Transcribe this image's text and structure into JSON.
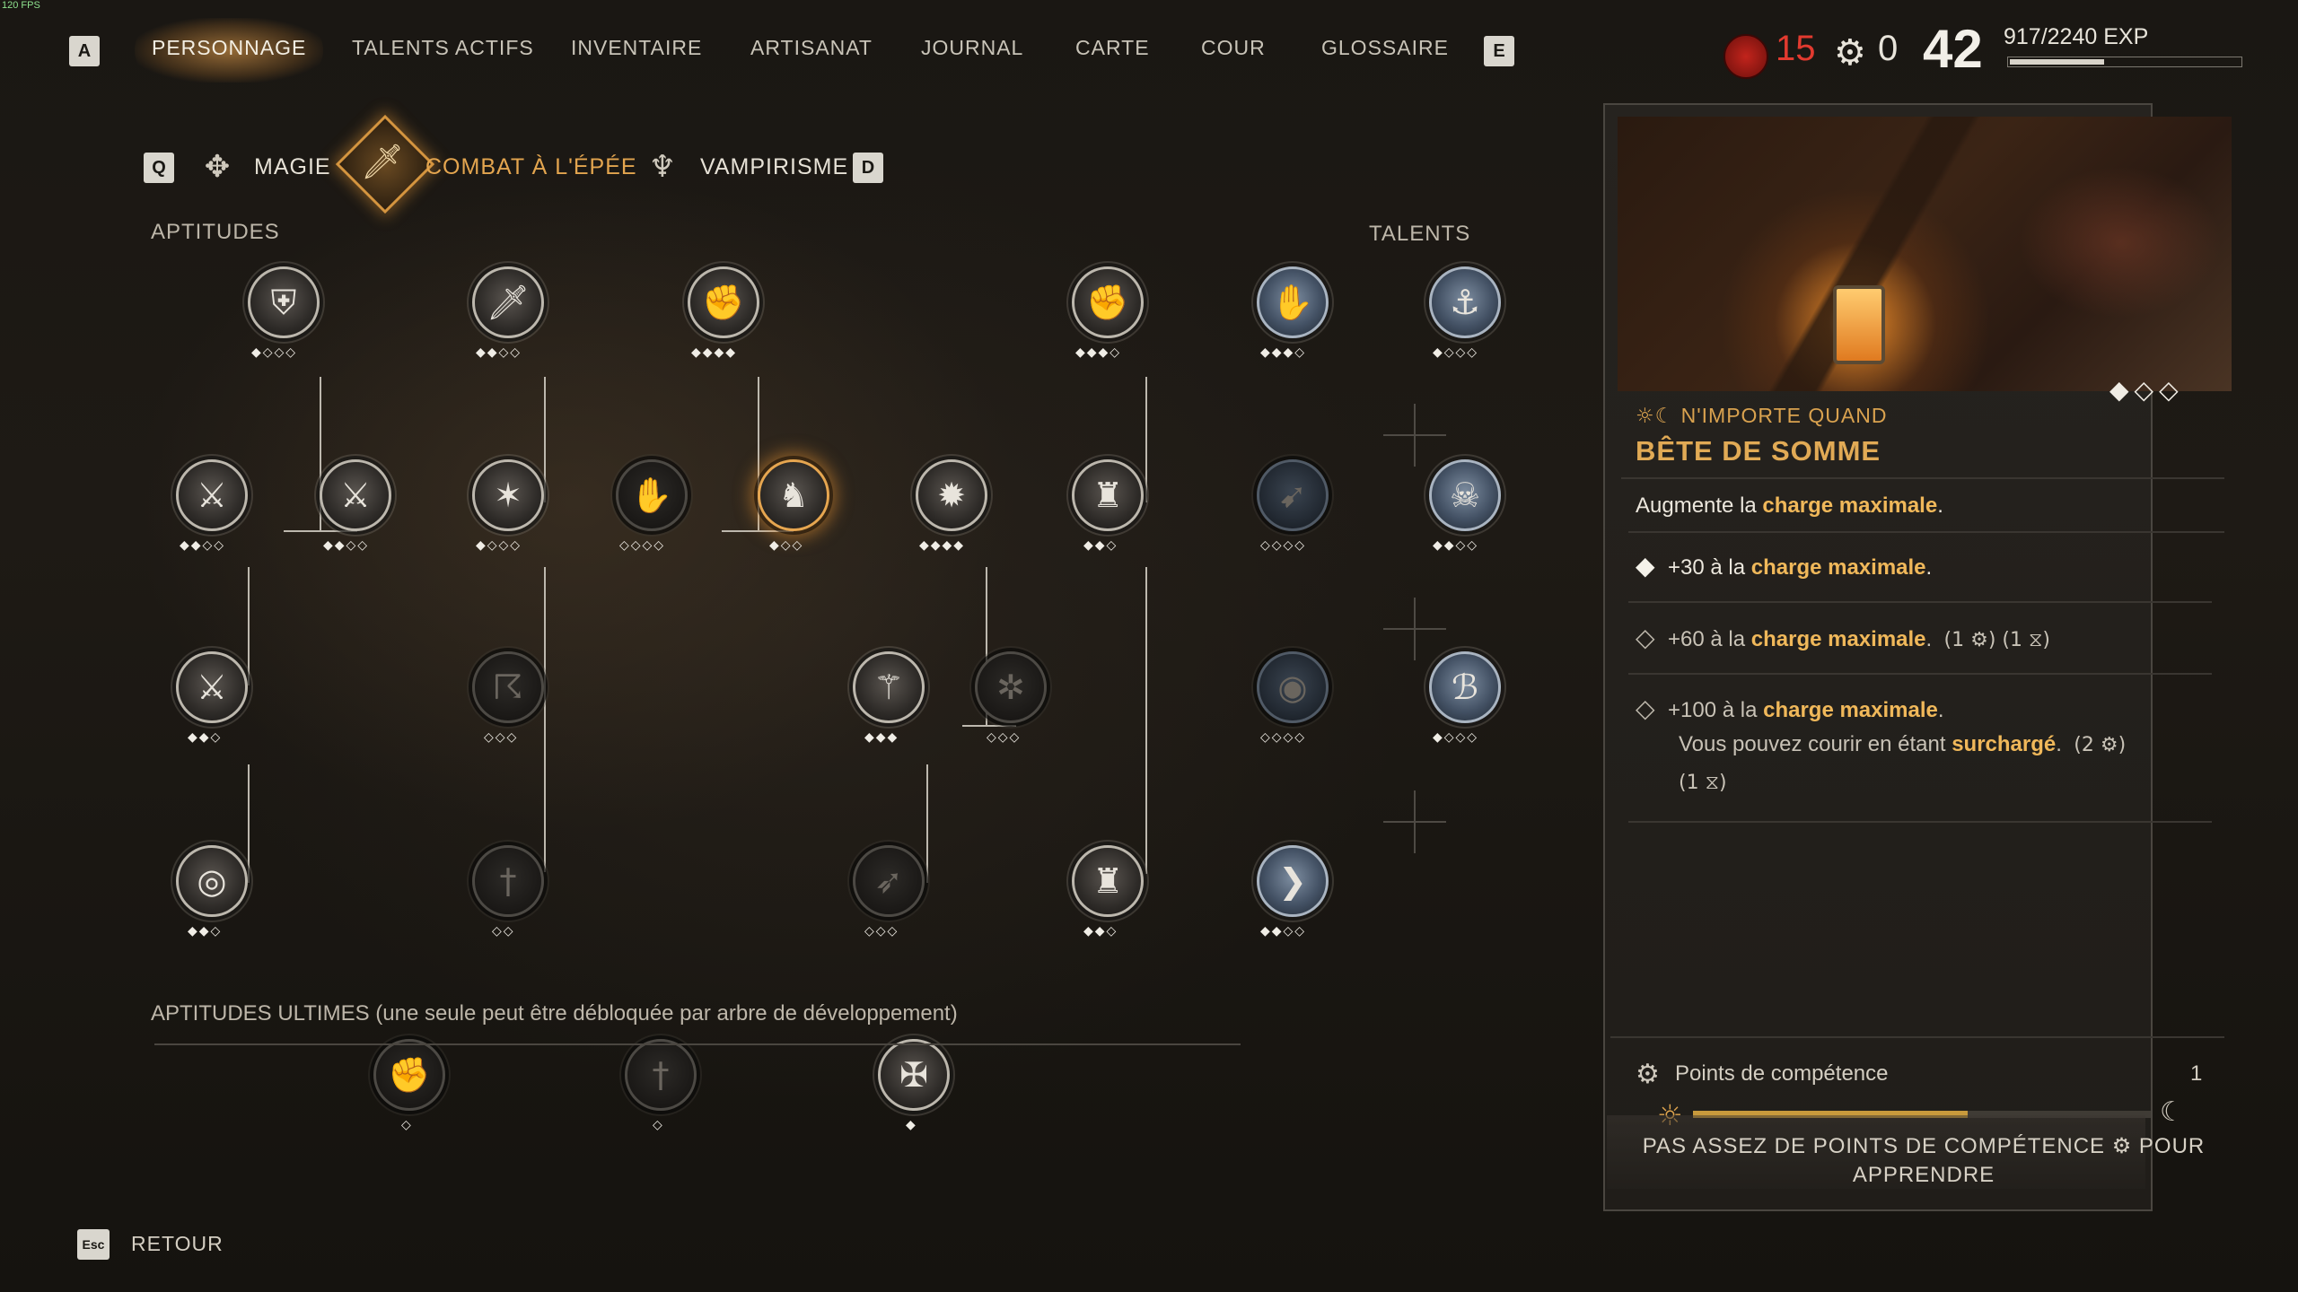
{
  "fps": "120 FPS",
  "nav": {
    "key_left": "A",
    "key_right": "E",
    "items": [
      "PERSONNAGE",
      "TALENTS ACTIFS",
      "INVENTAIRE",
      "ARTISANAT",
      "JOURNAL",
      "CARTE",
      "COUR",
      "GLOSSAIRE"
    ],
    "active_index": 0
  },
  "stats": {
    "red_value": "15",
    "gear_value": "0",
    "level": "42",
    "exp_text": "917/2240 EXP",
    "exp_progress": 0.409
  },
  "categories": {
    "key_left": "Q",
    "key_right": "D",
    "items": [
      "MAGIE",
      "COMBAT À L'ÉPÉE",
      "VAMPIRISME"
    ],
    "active_index": 1
  },
  "sections": {
    "aptitudes": "APTITUDES",
    "talents": "TALENTS",
    "ultimes": "APTITUDES ULTIMES (une seule peut être débloquée par arbre de développement)"
  },
  "skills": [
    {
      "icon": "shield-icon",
      "diamonds": "◆◇◇◇",
      "dim": false
    },
    {
      "icon": "dagger-icon",
      "diamonds": "◆◆◇◇",
      "dim": false
    },
    {
      "icon": "strength-icon",
      "diamonds": "◆◆◆◆",
      "dim": false
    },
    {
      "icon": "fist-icon",
      "diamonds": "◆◆◆◇",
      "dim": false
    },
    {
      "icon": "slash-icon",
      "diamonds": "◆◆◇◇",
      "dim": false
    },
    {
      "icon": "crossed-swords-icon",
      "diamonds": "◆◆◇◇",
      "dim": false
    },
    {
      "icon": "sword-burst-icon",
      "diamonds": "◆◇◇◇",
      "dim": false
    },
    {
      "icon": "claw-icon",
      "diamonds": "◇◇◇◇",
      "dim": true
    },
    {
      "icon": "pack-mule-icon",
      "diamonds": "◆◇◇",
      "dim": false,
      "selected": true
    },
    {
      "icon": "rage-icon",
      "diamonds": "◆◆◆◆",
      "dim": false
    },
    {
      "icon": "armor-icon",
      "diamonds": "◆◆◇",
      "dim": false
    },
    {
      "icon": "sword-swing-icon",
      "diamonds": "◆◆◇",
      "dim": false
    },
    {
      "icon": "hook-icon",
      "diamonds": "◇◇◇",
      "dim": true
    },
    {
      "icon": "blade-fan-icon",
      "diamonds": "◆◆◆",
      "dim": false
    },
    {
      "icon": "target-wheel-icon",
      "diamonds": "◇◇◇",
      "dim": true
    },
    {
      "icon": "bullseye-icon",
      "diamonds": "◆◆◇",
      "dim": false
    },
    {
      "icon": "sheathed-sword-icon",
      "diamonds": "◇◇",
      "dim": true
    },
    {
      "icon": "lunge-icon",
      "diamonds": "◇◇◇",
      "dim": true
    },
    {
      "icon": "plate-armor-icon",
      "diamonds": "◆◆◇",
      "dim": false
    }
  ],
  "talents": [
    {
      "icon": "hand-icon",
      "diamonds": "◆◆◆◇",
      "dim": false
    },
    {
      "icon": "anchor-icon",
      "diamonds": "◆◇◇◇",
      "dim": false
    },
    {
      "icon": "dash-icon",
      "diamonds": "◇◇◇◇",
      "dim": true
    },
    {
      "icon": "skull-icon",
      "diamonds": "◆◆◇◇",
      "dim": false
    },
    {
      "icon": "eye-icon",
      "diamonds": "◇◇◇◇",
      "dim": true
    },
    {
      "icon": "rune-icon",
      "diamonds": "◆◇◇◇",
      "dim": false
    },
    {
      "icon": "leap-icon",
      "diamonds": "◆◆◇◇",
      "dim": false
    }
  ],
  "ultimates": [
    {
      "icon": "fist-ultimate-icon",
      "diamonds": "◇",
      "dim": true
    },
    {
      "icon": "sword-ultimate-icon",
      "diamonds": "◇",
      "dim": true
    },
    {
      "icon": "blade-storm-ultimate-icon",
      "diamonds": "◆",
      "dim": false
    }
  ],
  "panel": {
    "gallery": "◆◇◇",
    "tag_icons": "☼☾",
    "tag": "N'IMPORTE QUAND",
    "title": "BÊTE DE SOMME",
    "desc_pre": "Augmente la ",
    "desc_hl": "charge maximale",
    "desc_post": ".",
    "tiers": [
      {
        "marker": "◆",
        "pre": "+30 à la ",
        "hl": "charge maximale",
        "post": ".",
        "req": ""
      },
      {
        "marker": "◇",
        "pre": "+60 à la ",
        "hl": "charge maximale",
        "post": ".",
        "req": "(1 ⚙) (1 ⧖)"
      },
      {
        "marker": "◇",
        "pre": "+100 à la ",
        "hl": "charge maximale",
        "post": ".",
        "line2_pre": "Vous pouvez courir en étant ",
        "line2_hl": "surchargé",
        "line2_post": ".",
        "req": "(2 ⚙)",
        "req2": "(1 ⧖)"
      }
    ],
    "skill_points_label": "Points de compétence",
    "skill_points_value": "1",
    "progress": 0.6,
    "warning_line1": "PAS ASSEZ DE POINTS DE COMPÉTENCE ⚙ POUR",
    "warning_line2": "APPRENDRE"
  },
  "footer": {
    "key": "Esc",
    "label": "RETOUR"
  }
}
